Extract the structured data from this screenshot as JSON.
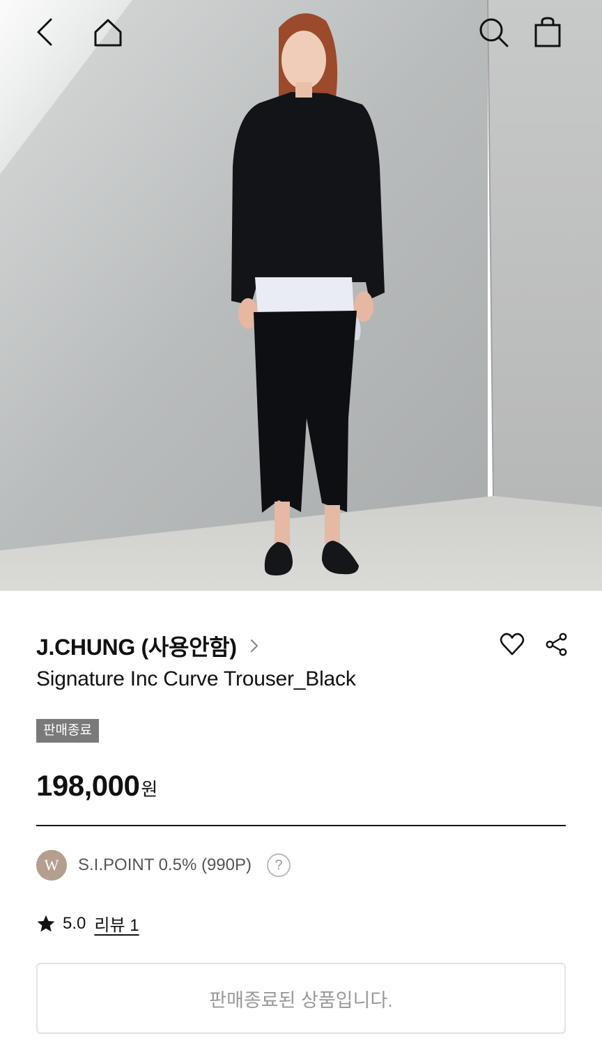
{
  "hero": {
    "image_alt": "Model wearing Signature Inc Curve Trouser_Black"
  },
  "topbar": {
    "back_icon": "chevron-left-icon",
    "home_icon": "home-icon",
    "search_icon": "search-icon",
    "cart_icon": "shopping-bag-icon"
  },
  "product": {
    "brand": "J.CHUNG (사용안함)",
    "name": "Signature Inc Curve Trouser_Black",
    "status_badge": "판매종료",
    "price": "198,000",
    "currency": "원",
    "point_badge": "W",
    "point_text": "S.I.POINT 0.5% (990P)",
    "help_symbol": "?",
    "rating": "5.0",
    "review_label": "리뷰 1",
    "soldout_message": "판매종료된 상품입니다."
  },
  "colors": {
    "badge_bg": "#7a7a7a",
    "point_badge_bg": "#b49e8e",
    "text_primary": "#111111",
    "text_muted": "#999999"
  }
}
